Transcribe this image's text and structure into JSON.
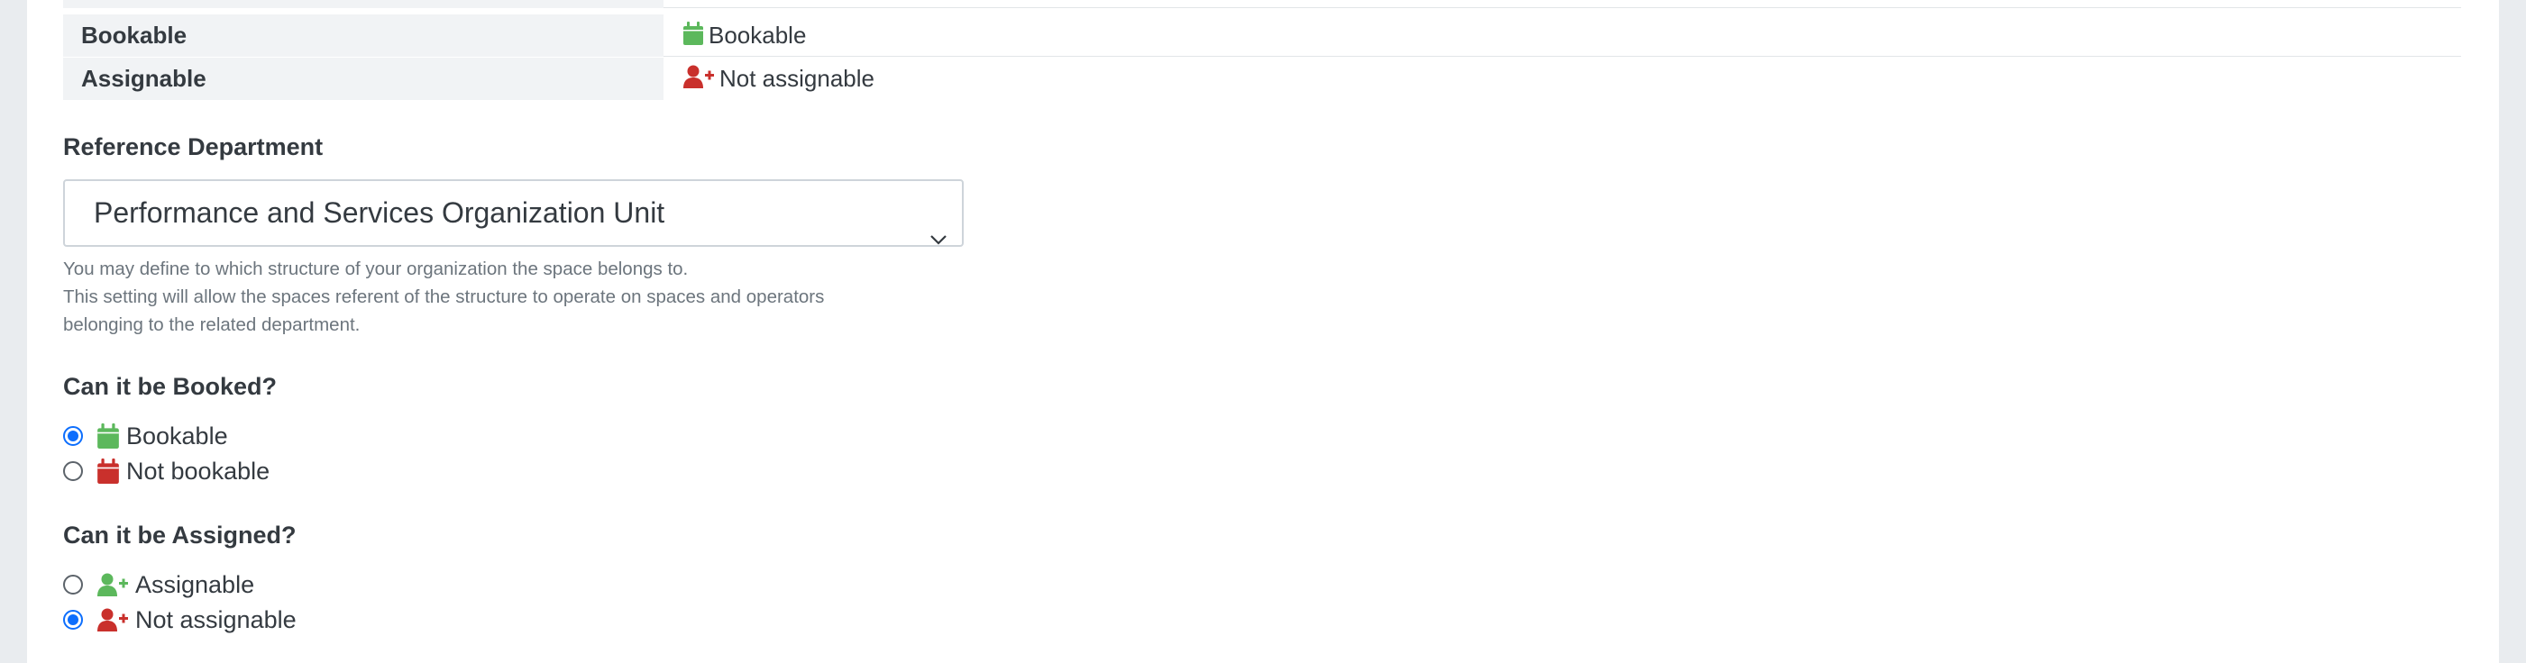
{
  "summary": {
    "rows": [
      {
        "key": "Bookable",
        "value": "Bookable",
        "icon": "calendar-icon",
        "color": "#5cb85c"
      },
      {
        "key": "Assignable",
        "value": "Not assignable",
        "icon": "user-plus-icon",
        "color": "#c9302c"
      }
    ]
  },
  "department": {
    "label": "Reference Department",
    "selected": "Performance and Services Organization Unit",
    "help_lines": [
      "You may define to which structure of your organization the space belongs to.",
      "This setting will allow the spaces referent of the structure to operate on spaces and operators",
      "belonging to the related department."
    ]
  },
  "booking": {
    "label": "Can it be Booked?",
    "options": [
      {
        "label": "Bookable",
        "checked": true,
        "icon": "calendar-icon",
        "color": "#5cb85c"
      },
      {
        "label": "Not bookable",
        "checked": false,
        "icon": "calendar-icon",
        "color": "#c9302c"
      }
    ]
  },
  "assignment": {
    "label": "Can it be Assigned?",
    "options": [
      {
        "label": "Assignable",
        "checked": false,
        "icon": "user-plus-icon",
        "color": "#5cb85c"
      },
      {
        "label": "Not assignable",
        "checked": true,
        "icon": "user-plus-icon",
        "color": "#c9302c"
      }
    ]
  },
  "colors": {
    "accent": "#0d6efd",
    "success": "#5cb85c",
    "danger": "#c9302c"
  }
}
